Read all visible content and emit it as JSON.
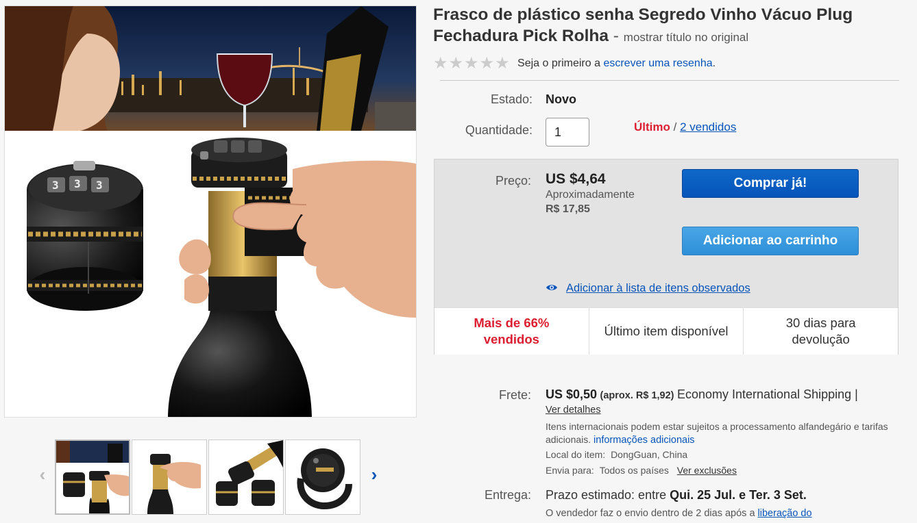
{
  "product": {
    "title": "Frasco de plástico senha Segredo Vinho Vácuo Plug Fechadura Pick Rolha",
    "title_separator": "-",
    "show_original": "mostrar título no original"
  },
  "rating": {
    "stars": "★★★★★",
    "prefix": "Seja o primeiro a",
    "link": "escrever uma resenha",
    "suffix": "."
  },
  "condition": {
    "label": "Estado:",
    "value": "Novo"
  },
  "quantity": {
    "label": "Quantidade:",
    "value": "1",
    "last_label": "Último",
    "separator": "/",
    "sold_link": "2 vendidos"
  },
  "price": {
    "label": "Preço:",
    "value": "US $4,64",
    "approx_label": "Aproximadamente",
    "approx_value": "R$ 17,85"
  },
  "buttons": {
    "buy_now": "Comprar já!",
    "add_to_cart": "Adicionar ao carrinho",
    "watch": "Adicionar à lista de itens observados"
  },
  "highlights": [
    {
      "text": "Mais de 66% vendidos"
    },
    {
      "text": "Último item disponível"
    },
    {
      "text": "30 dias para devolução"
    }
  ],
  "shipping": {
    "label": "Frete:",
    "price": "US $0,50",
    "approx": "(aprox. R$ 1,92)",
    "service": "Economy International Shipping |",
    "details_link": "Ver detalhes",
    "customs_note": "Itens internacionais podem estar sujeitos a processamento alfandegário e tarifas adicionais.",
    "more_info_link": "informações adicionais",
    "location_label": "Local do item:",
    "location": "DongGuan, China",
    "ships_to_label": "Envia para:",
    "ships_to": "Todos os países",
    "exclusions_link": "Ver exclusões"
  },
  "delivery": {
    "label": "Entrega:",
    "prefix": "Prazo estimado: entre",
    "dates": "Qui. 25 Jul. e Ter. 3 Set.",
    "note": "O vendedor faz o envio dentro de 2 dias após a",
    "note_link": "liberação do"
  },
  "gallery": {
    "prev_arrow": "‹",
    "next_arrow": "›",
    "thumbnails": [
      "thumb-1",
      "thumb-2",
      "thumb-3",
      "thumb-4"
    ]
  },
  "colors": {
    "link": "#0654ba",
    "alert_red": "#dd1e31",
    "buy_button": "#0654ba",
    "cart_button": "#3b9ae1"
  }
}
